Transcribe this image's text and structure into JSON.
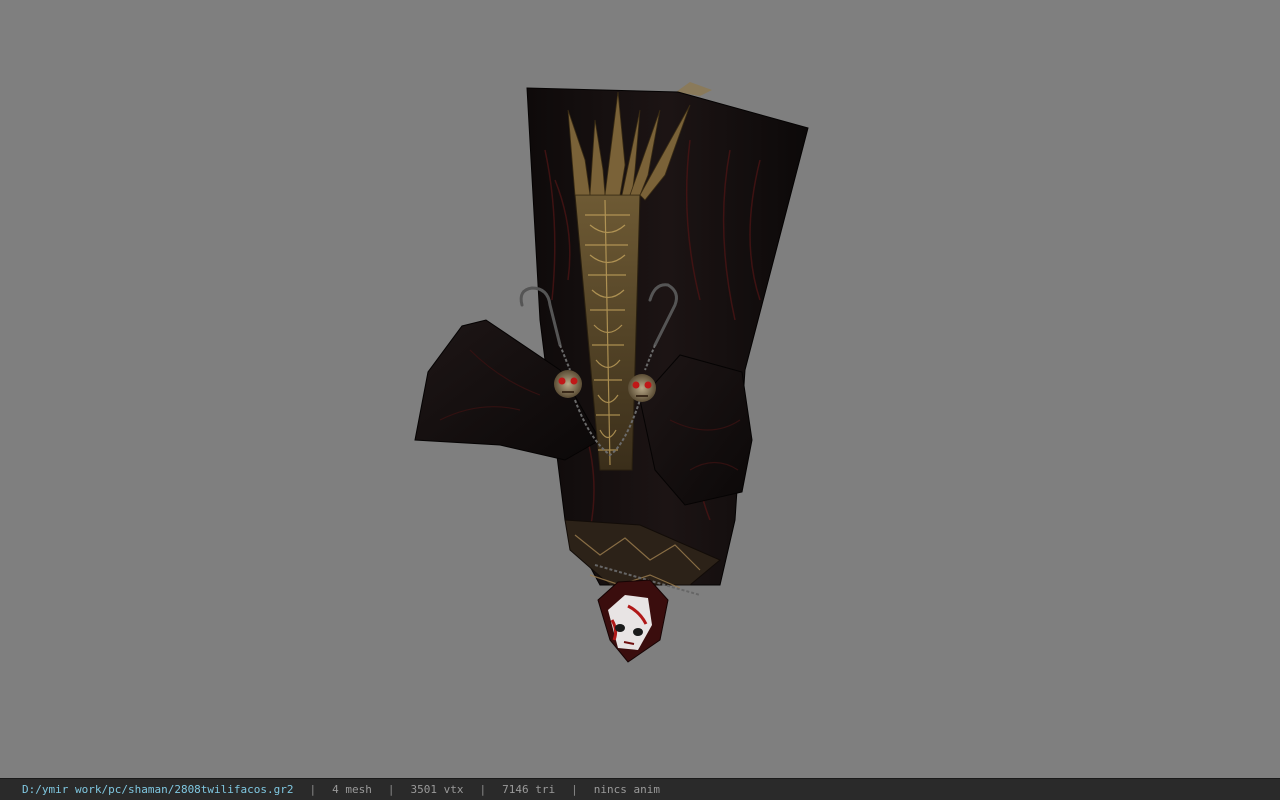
{
  "viewer": {
    "background_color": "#7f7f7f",
    "model_icon": "shaman-costume-model"
  },
  "status_bar": {
    "file_path": "D:/ymir work/pc/shaman/2808twilifacos.gr2",
    "separator": "|",
    "mesh_count": "4 mesh",
    "vertex_count": "3501 vtx",
    "triangle_count": "7146 tri",
    "anim_status": "nincs anim",
    "path_color": "#7fc7e0"
  }
}
